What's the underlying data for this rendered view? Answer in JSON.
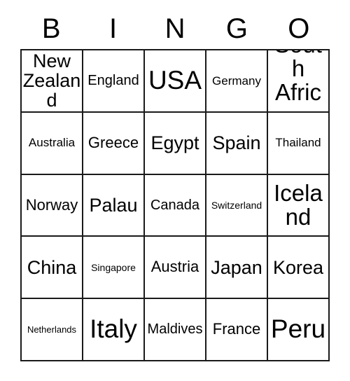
{
  "card": {
    "title_letters": [
      "B",
      "I",
      "N",
      "G",
      "O"
    ],
    "columns": 5,
    "rows": 5,
    "colors": {
      "background": "#ffffff",
      "border": "#1a1a1a",
      "text": "#000000"
    },
    "cells": [
      [
        {
          "label": "New Zealand",
          "size": "md"
        },
        {
          "label": "England",
          "size": "xs"
        },
        {
          "label": "USA",
          "size": "xl"
        },
        {
          "label": "Germany",
          "size": "xxs"
        },
        {
          "label": "South Africa",
          "size": "lg"
        }
      ],
      [
        {
          "label": "Australia",
          "size": "xxs"
        },
        {
          "label": "Greece",
          "size": "sm"
        },
        {
          "label": "Egypt",
          "size": "md"
        },
        {
          "label": "Spain",
          "size": "md"
        },
        {
          "label": "Thailand",
          "size": "xxs"
        }
      ],
      [
        {
          "label": "Norway",
          "size": "sm"
        },
        {
          "label": "Palau",
          "size": "md"
        },
        {
          "label": "Canada",
          "size": "xs"
        },
        {
          "label": "Switzerland",
          "size": "tiny"
        },
        {
          "label": "Iceland",
          "size": "lg"
        }
      ],
      [
        {
          "label": "China",
          "size": "md"
        },
        {
          "label": "Singapore",
          "size": "tiny"
        },
        {
          "label": "Austria",
          "size": "sm"
        },
        {
          "label": "Japan",
          "size": "md"
        },
        {
          "label": "Korea",
          "size": "md"
        }
      ],
      [
        {
          "label": "Netherlands",
          "size": "mini"
        },
        {
          "label": "Italy",
          "size": "xl"
        },
        {
          "label": "Maldives",
          "size": "xs"
        },
        {
          "label": "France",
          "size": "sm"
        },
        {
          "label": "Peru",
          "size": "xl"
        }
      ]
    ]
  }
}
